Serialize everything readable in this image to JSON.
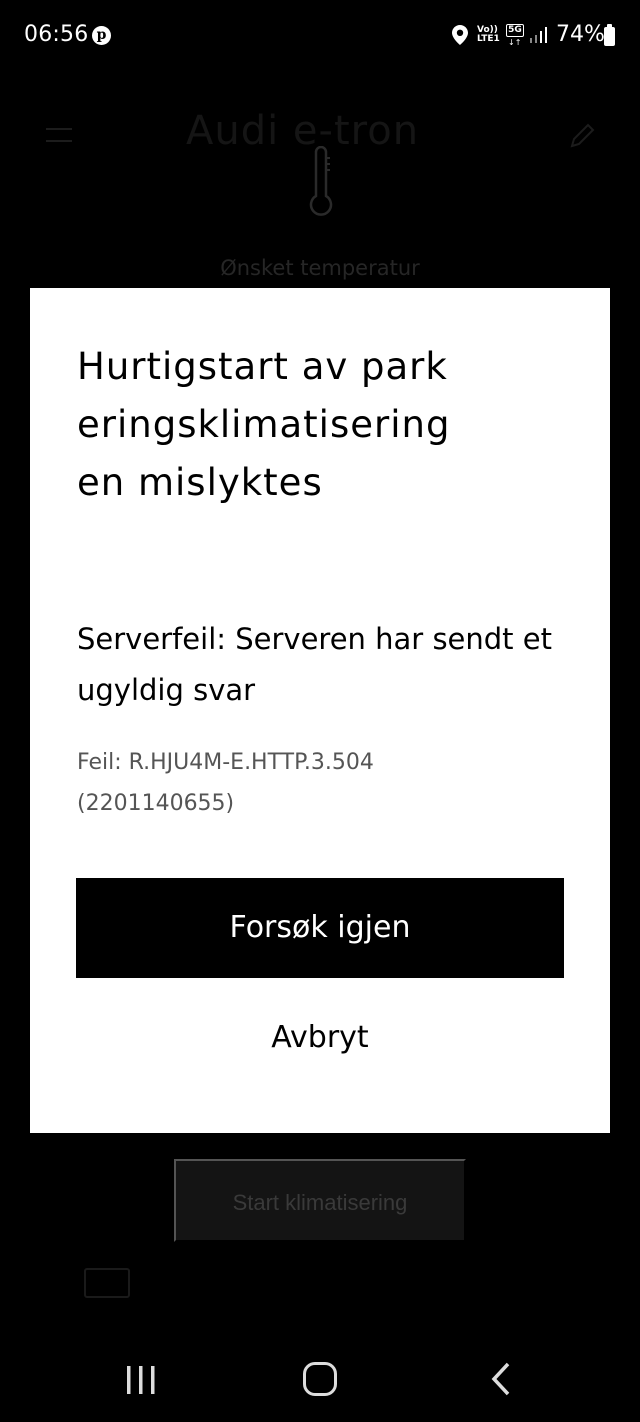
{
  "status_bar": {
    "time": "06:56",
    "pinterest_glyph": "p",
    "volte_line1": "Vo))",
    "volte_line2": "LTE1",
    "network_5g": "5G",
    "battery_percent": "74%",
    "icons": [
      "pinterest-icon",
      "location-icon",
      "volte-icon",
      "5g-icon",
      "signal-icon",
      "battery-icon"
    ]
  },
  "background": {
    "app_title": "Audi e-tron",
    "temperature_label": "Ønsket temperatur",
    "start_button_label": "Start klimatisering"
  },
  "dialog": {
    "title": "Hurtigstart av parkeringsklimatiseringen mislyktes",
    "message": "Serverfeil: Serveren har sendt et ugyldig svar",
    "error_code": "Feil: R.HJU4M-E.HTTP.3.504 (2201140655)",
    "retry_label": "Forsøk igjen",
    "cancel_label": "Avbryt"
  },
  "nav_bar": {
    "icons": [
      "recent-apps-icon",
      "home-icon",
      "back-icon"
    ]
  }
}
